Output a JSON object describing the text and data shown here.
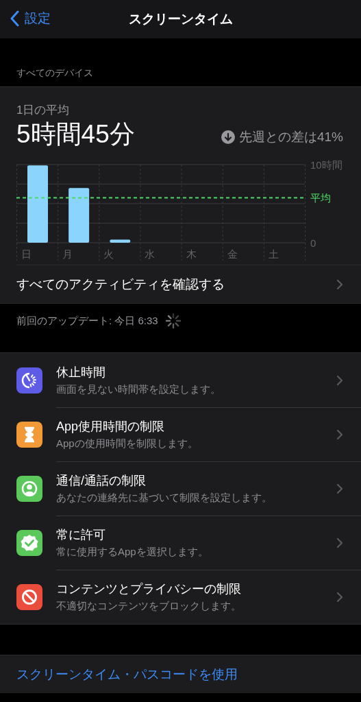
{
  "nav": {
    "back_label": "設定",
    "title": "スクリーンタイム"
  },
  "section_header": "すべてのデバイス",
  "summary": {
    "label": "1日の平均",
    "value": "5時間45分",
    "comparison": "先週との差は41%",
    "kind": "decrease"
  },
  "chart_data": {
    "type": "bar",
    "categories": [
      "日",
      "月",
      "火",
      "水",
      "木",
      "金",
      "土"
    ],
    "series": [
      {
        "color": "#8ad4fe",
        "values": [
          9.9,
          7.0,
          0.4,
          null,
          null,
          null,
          null
        ]
      }
    ],
    "ylim": [
      0,
      10
    ],
    "yticks": [
      {
        "value": 0,
        "label": "0"
      },
      {
        "value": 10,
        "label": "10時間"
      }
    ],
    "ref_lines": [
      {
        "axis": "y",
        "value": 5.75,
        "label": "平均",
        "color": "#4cd964"
      }
    ]
  },
  "activity_link": "すべてのアクティビティを確認する",
  "last_update": "前回のアップデート: 今日 6:33",
  "items": [
    {
      "title": "休止時間",
      "subtitle": "画面を見ない時間帯を設定します。",
      "kind": "downtime",
      "color": "#5e5ce6"
    },
    {
      "title": "App使用時間の制限",
      "subtitle": "Appの使用時間を制限します。",
      "kind": "hourglass",
      "color": "#f19a37"
    },
    {
      "title": "通信/通話の制限",
      "subtitle": "あなたの連絡先に基づいて制限を設定します。",
      "kind": "person",
      "color": "#5ac85a"
    },
    {
      "title": "常に許可",
      "subtitle": "常に使用するAppを選択します。",
      "kind": "check",
      "color": "#5ac85a"
    },
    {
      "title": "コンテンツとプライバシーの制限",
      "subtitle": "不適切なコンテンツをブロックします。",
      "kind": "block",
      "color": "#eb4d3d"
    }
  ],
  "passcode_link": "スクリーンタイム・パスコードを使用"
}
